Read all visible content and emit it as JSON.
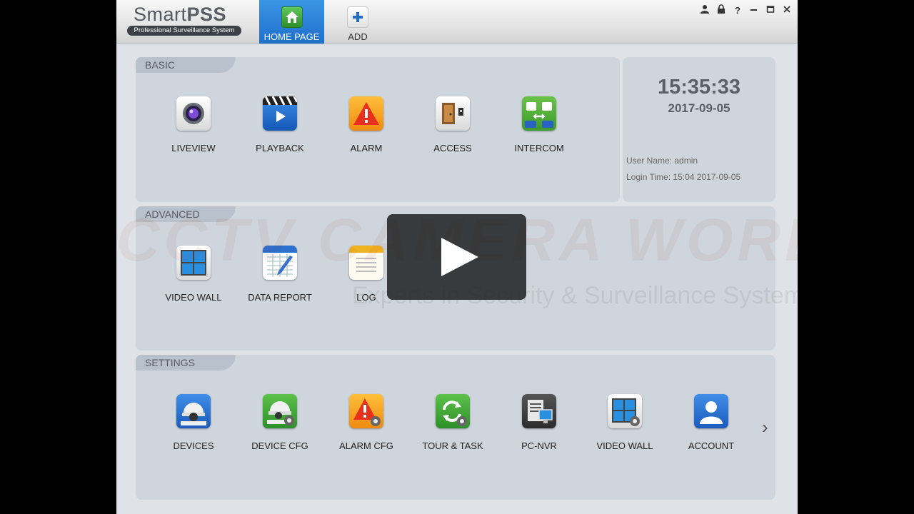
{
  "app": {
    "brand_light": "Smart",
    "brand_bold": "PSS",
    "brand_sub": "Professional Surveillance System",
    "tabs": [
      {
        "label": "HOME PAGE",
        "icon": "home-icon"
      },
      {
        "label": "ADD",
        "icon": "plus-icon"
      }
    ],
    "window_controls": [
      "user-icon",
      "lock-icon",
      "help-icon",
      "minimize-icon",
      "maximize-icon",
      "close-icon"
    ]
  },
  "basic": {
    "label": "BASIC",
    "items": [
      {
        "label": "LIVEVIEW",
        "icon": "camera-lens-icon"
      },
      {
        "label": "PLAYBACK",
        "icon": "clapper-play-icon"
      },
      {
        "label": "ALARM",
        "icon": "alarm-warning-icon"
      },
      {
        "label": "ACCESS",
        "icon": "door-icon"
      },
      {
        "label": "INTERCOM",
        "icon": "intercom-icon"
      }
    ]
  },
  "status": {
    "time": "15:35:33",
    "date": "2017-09-05",
    "user_name_label": "User Name:",
    "user_name": "admin",
    "login_time_label": "Login Time:",
    "login_time": "15:04 2017-09-05"
  },
  "advanced": {
    "label": "ADVANCED",
    "items": [
      {
        "label": "VIDEO WALL",
        "icon": "video-wall-icon"
      },
      {
        "label": "DATA REPORT",
        "icon": "calendar-report-icon"
      },
      {
        "label": "LOG",
        "icon": "notepad-log-icon"
      }
    ]
  },
  "settings": {
    "label": "SETTINGS",
    "items": [
      {
        "label": "DEVICES",
        "icon": "dome-camera-icon"
      },
      {
        "label": "DEVICE CFG",
        "icon": "dome-camera-gear-icon"
      },
      {
        "label": "ALARM CFG",
        "icon": "alarm-gear-icon"
      },
      {
        "label": "TOUR & TASK",
        "icon": "refresh-gear-icon"
      },
      {
        "label": "PC-NVR",
        "icon": "pc-nvr-icon"
      },
      {
        "label": "VIDEO WALL",
        "icon": "video-wall-gear-icon"
      },
      {
        "label": "ACCOUNT",
        "icon": "account-icon"
      }
    ]
  },
  "watermark": {
    "line1": "CCTV CAMERA WORLD",
    "line2": "Experts in Security & Surveillance Systems"
  },
  "colors": {
    "accent": "#1f6fc9",
    "panel": "#cfd5dc",
    "background": "#dfe3e7"
  }
}
